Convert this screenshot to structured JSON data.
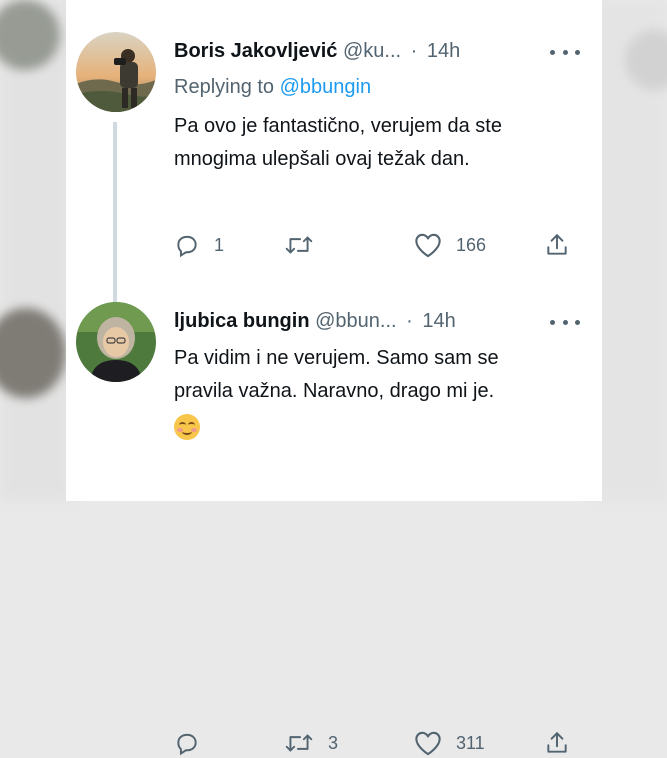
{
  "tweets": [
    {
      "author_name": "Boris Jakovljević",
      "handle": "@ku...",
      "separator": "·",
      "time": "14h",
      "replying_prefix": "Replying to ",
      "replying_to": "@bbungin",
      "text": "Pa ovo je fantastično, verujem da ste mnogima ulepšali ovaj težak dan.",
      "reply_count": "1",
      "retweet_count": "",
      "like_count": "166"
    },
    {
      "author_name": "ljubica bungin",
      "handle": "@bbun...",
      "separator": "·",
      "time": "14h",
      "text": "Pa vidim i ne verujem. Samo sam se pravila važna. Naravno, drago mi je.",
      "reply_count": "",
      "retweet_count": "3",
      "like_count": "311"
    }
  ],
  "icons": {
    "reply": "reply-icon",
    "retweet": "retweet-icon",
    "like": "heart-icon",
    "share": "share-icon",
    "more": "more-icon",
    "emoji": "smiling-face-emoji"
  },
  "colors": {
    "link": "#1d9bf0",
    "secondary_text": "#536471",
    "primary_text": "#0f1419"
  }
}
